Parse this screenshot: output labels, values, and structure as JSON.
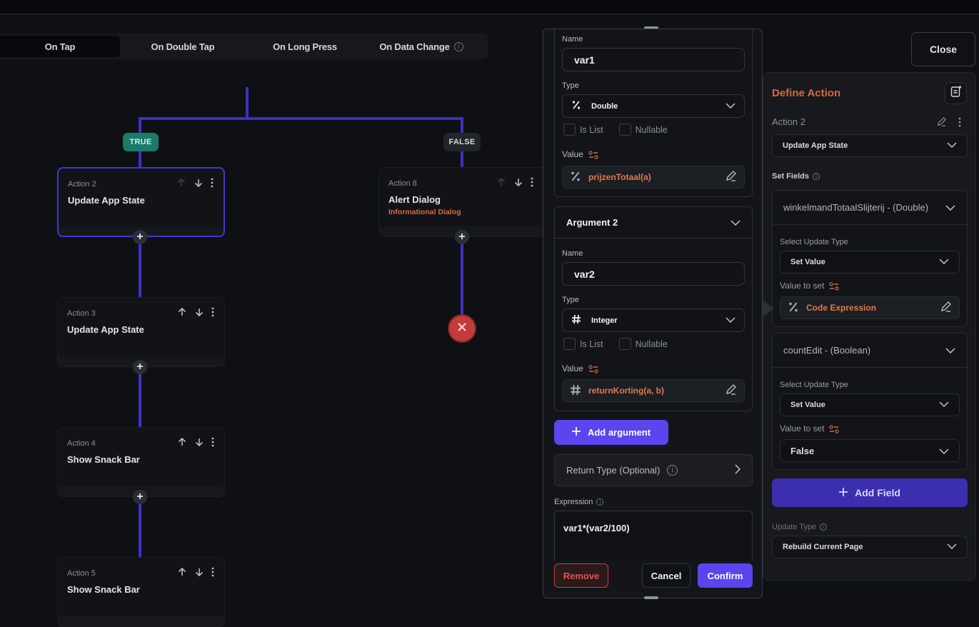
{
  "triggers": {
    "tabs": [
      {
        "label": "On Tap",
        "active": true
      },
      {
        "label": "On Double Tap",
        "active": false
      },
      {
        "label": "On Long Press",
        "active": false
      },
      {
        "label": "On Data Change",
        "active": false,
        "info": true
      }
    ]
  },
  "flow": {
    "true_label": "TRUE",
    "false_label": "FALSE",
    "actions": [
      {
        "number": "Action 2",
        "title": "Update App State",
        "subtitle": "",
        "selected": true
      },
      {
        "number": "Action 3",
        "title": "Update App State",
        "subtitle": ""
      },
      {
        "number": "Action 4",
        "title": "Show Snack Bar",
        "subtitle": ""
      },
      {
        "number": "Action 5",
        "title": "Show Snack Bar",
        "subtitle": ""
      },
      {
        "number": "Action 8",
        "title": "Alert Dialog",
        "subtitle": "Informational Dialog"
      }
    ],
    "line_color": "#3f2fc4"
  },
  "expression_panel": {
    "argument1": {
      "name_label": "Name",
      "name_value": "var1",
      "type_label": "Type",
      "type_icon": "percent-icon",
      "type_value": "Double",
      "is_list_label": "Is List",
      "nullable_label": "Nullable",
      "value_label": "Value",
      "value_icon": "percent-icon",
      "value": "prijzenTotaal(a)"
    },
    "argument2": {
      "header": "Argument 2",
      "name_label": "Name",
      "name_value": "var2",
      "type_label": "Type",
      "type_icon": "hash-icon",
      "type_value": "Integer",
      "is_list_label": "Is List",
      "nullable_label": "Nullable",
      "value_label": "Value",
      "value_icon": "hash-icon",
      "value": "returnKorting(a, b)"
    },
    "add_argument_label": "Add argument",
    "return_type_label": "Return Type (Optional)",
    "expression_label": "Expression",
    "expression_value": "var1*(var2/100)",
    "remove_label": "Remove",
    "cancel_label": "Cancel",
    "confirm_label": "Confirm"
  },
  "right_panel": {
    "close_label": "Close",
    "title": "Define Action",
    "action_label": "Action 2",
    "action_type": "Update App State",
    "set_fields_label": "Set Fields",
    "fields": [
      {
        "header": "winkelmandTotaalSlijterij - (Double)",
        "update_type_label": "Select Update Type",
        "update_type_value": "Set Value",
        "value_label": "Value to set",
        "value": "Code Expression"
      },
      {
        "header": "countEdit - (Boolean)",
        "update_type_label": "Select Update Type",
        "update_type_value": "Set Value",
        "value_label": "Value to set",
        "value": "False"
      }
    ],
    "add_field_label": "Add Field",
    "update_type_label": "Update Type",
    "update_type_value": "Rebuild Current Page"
  },
  "colors": {
    "accent": "#5a45ef",
    "orange": "#d8693f",
    "true_badge": "#1c7a68",
    "danger": "#c43b3b"
  }
}
